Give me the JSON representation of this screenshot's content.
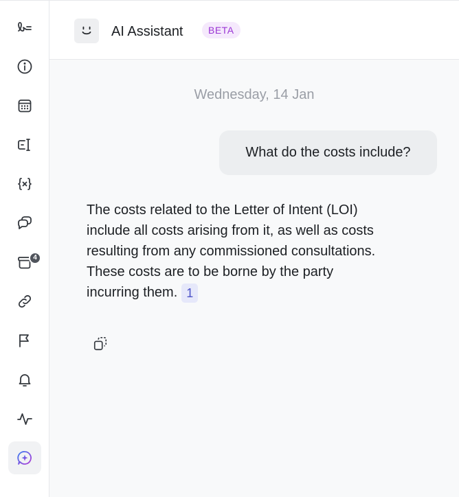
{
  "header": {
    "title": "AI Assistant",
    "badge": "BETA"
  },
  "sidebar": {
    "items": [
      {
        "name": "logo",
        "icon": "signature-icon"
      },
      {
        "name": "info",
        "icon": "info-icon"
      },
      {
        "name": "calendar",
        "icon": "calendar-icon"
      },
      {
        "name": "fields",
        "icon": "text-field-icon"
      },
      {
        "name": "variables",
        "icon": "variable-icon"
      },
      {
        "name": "comments",
        "icon": "chat-bubbles-icon"
      },
      {
        "name": "archive",
        "icon": "archive-box-icon",
        "badge": "4"
      },
      {
        "name": "links",
        "icon": "link-icon"
      },
      {
        "name": "flags",
        "icon": "flag-icon"
      },
      {
        "name": "notifications",
        "icon": "bell-icon"
      },
      {
        "name": "activity",
        "icon": "activity-icon"
      },
      {
        "name": "ai-assistant",
        "icon": "ai-sparkle-icon",
        "active": true
      }
    ]
  },
  "chat": {
    "date": "Wednesday, 14 Jan",
    "user_message": "What do the costs include?",
    "assistant_message": "The costs related to the Letter of Intent (LOI) include all costs arising from it, as well as costs resulting from any commissioned consultations. These costs are to be borne by the party incurring them.",
    "citation": "1"
  },
  "colors": {
    "accent": "#4c52c7",
    "beta_text": "#9a35d4",
    "beta_bg": "#f5e9fc"
  }
}
